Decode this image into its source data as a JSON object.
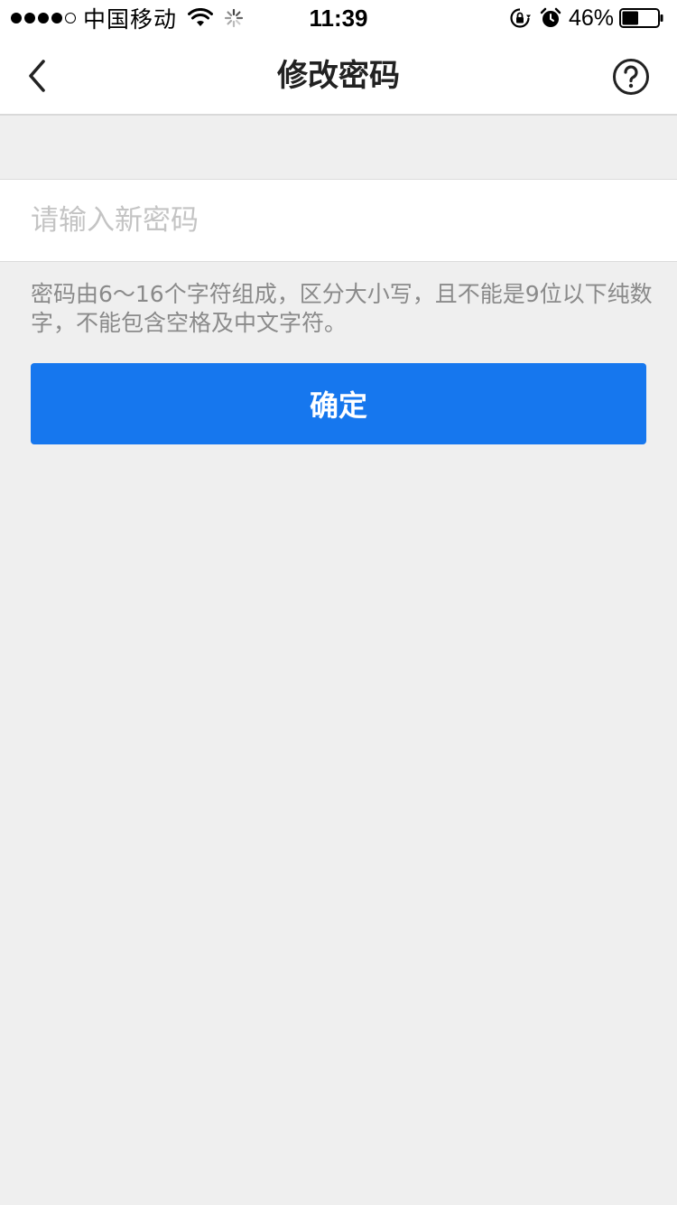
{
  "status_bar": {
    "carrier": "中国移动",
    "time": "11:39",
    "battery_percent": "46%",
    "battery_level": 0.46,
    "signal_bars_filled": 4,
    "signal_bars_total": 5,
    "icons": [
      "wifi-icon",
      "loading-spinner-icon",
      "rotation-lock-icon",
      "alarm-icon",
      "battery-icon"
    ]
  },
  "nav": {
    "title": "修改密码",
    "back_icon": "chevron-left-icon",
    "help_icon": "help-circle-icon"
  },
  "form": {
    "password_placeholder": "请输入新密码",
    "password_value": "",
    "hint": "密码由6～16个字符组成，区分大小写，且不能是9位以下纯数字，不能包含空格及中文字符。",
    "confirm_label": "确定"
  },
  "colors": {
    "primary_button": "#1677ee",
    "page_background": "#efefef",
    "hint_text": "#8a8a8a",
    "placeholder_text": "#c4c4c4"
  }
}
